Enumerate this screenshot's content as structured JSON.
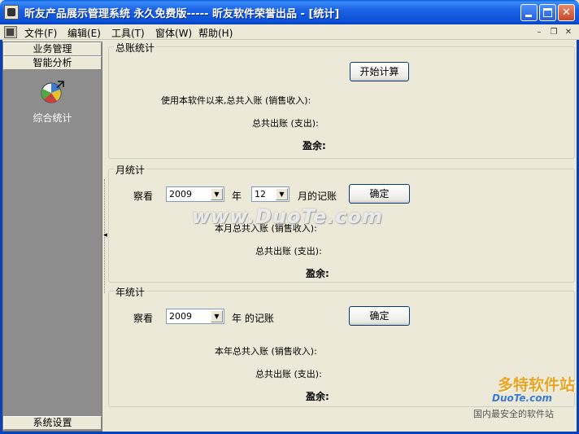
{
  "window": {
    "title": "昕友产品展示管理系统  永久免费版-----  昕友软件荣誉出品    - [统计]",
    "minimize_label": "",
    "maximize_label": "",
    "close_label": "✕"
  },
  "menubar": {
    "items": [
      "文件(F)",
      "编辑(E)",
      "工具(T)",
      "窗体(W)",
      "帮助(H)"
    ],
    "mdi_minimize": "–",
    "mdi_restore": "❐",
    "mdi_close": "✕"
  },
  "leftpanel": {
    "headers": [
      "业务管理",
      "智能分析"
    ],
    "stat_item_label": "综合统计",
    "bottom_header": "系统设置"
  },
  "total_stats": {
    "title": "总账统计",
    "start_button": "开始计算",
    "income_label": "使用本软件以来,总共入账 (销售收入):",
    "expense_label": "总共出账 (支出):",
    "balance_label": "盈余:"
  },
  "month_stats": {
    "title": "月统计",
    "view_label": "察看",
    "year_value": "2009",
    "year_label": "年",
    "month_value": "12",
    "month_suffix": "月的记账",
    "confirm_button": "确定",
    "income_label": "本月总共入账 (销售收入):",
    "expense_label": "总共出账 (支出):",
    "balance_label": "盈余:"
  },
  "year_stats": {
    "title": "年统计",
    "view_label": "察看",
    "year_value": "2009",
    "year_suffix": "年 的记账",
    "confirm_button": "确定",
    "income_label": "本年总共入账 (销售收入):",
    "expense_label": "总共出账 (支出):",
    "balance_label": "盈余:"
  },
  "watermarks": {
    "center": "www.DuoTe.com",
    "corner_top": "多特软件站",
    "corner_mid": "DuoTe.com",
    "corner_bottom": "国内最安全的软件站"
  },
  "colors": {
    "titlebar": "#0a4fd6",
    "panel_gray": "#8d8d8d",
    "window_bg": "#ece9d8"
  }
}
